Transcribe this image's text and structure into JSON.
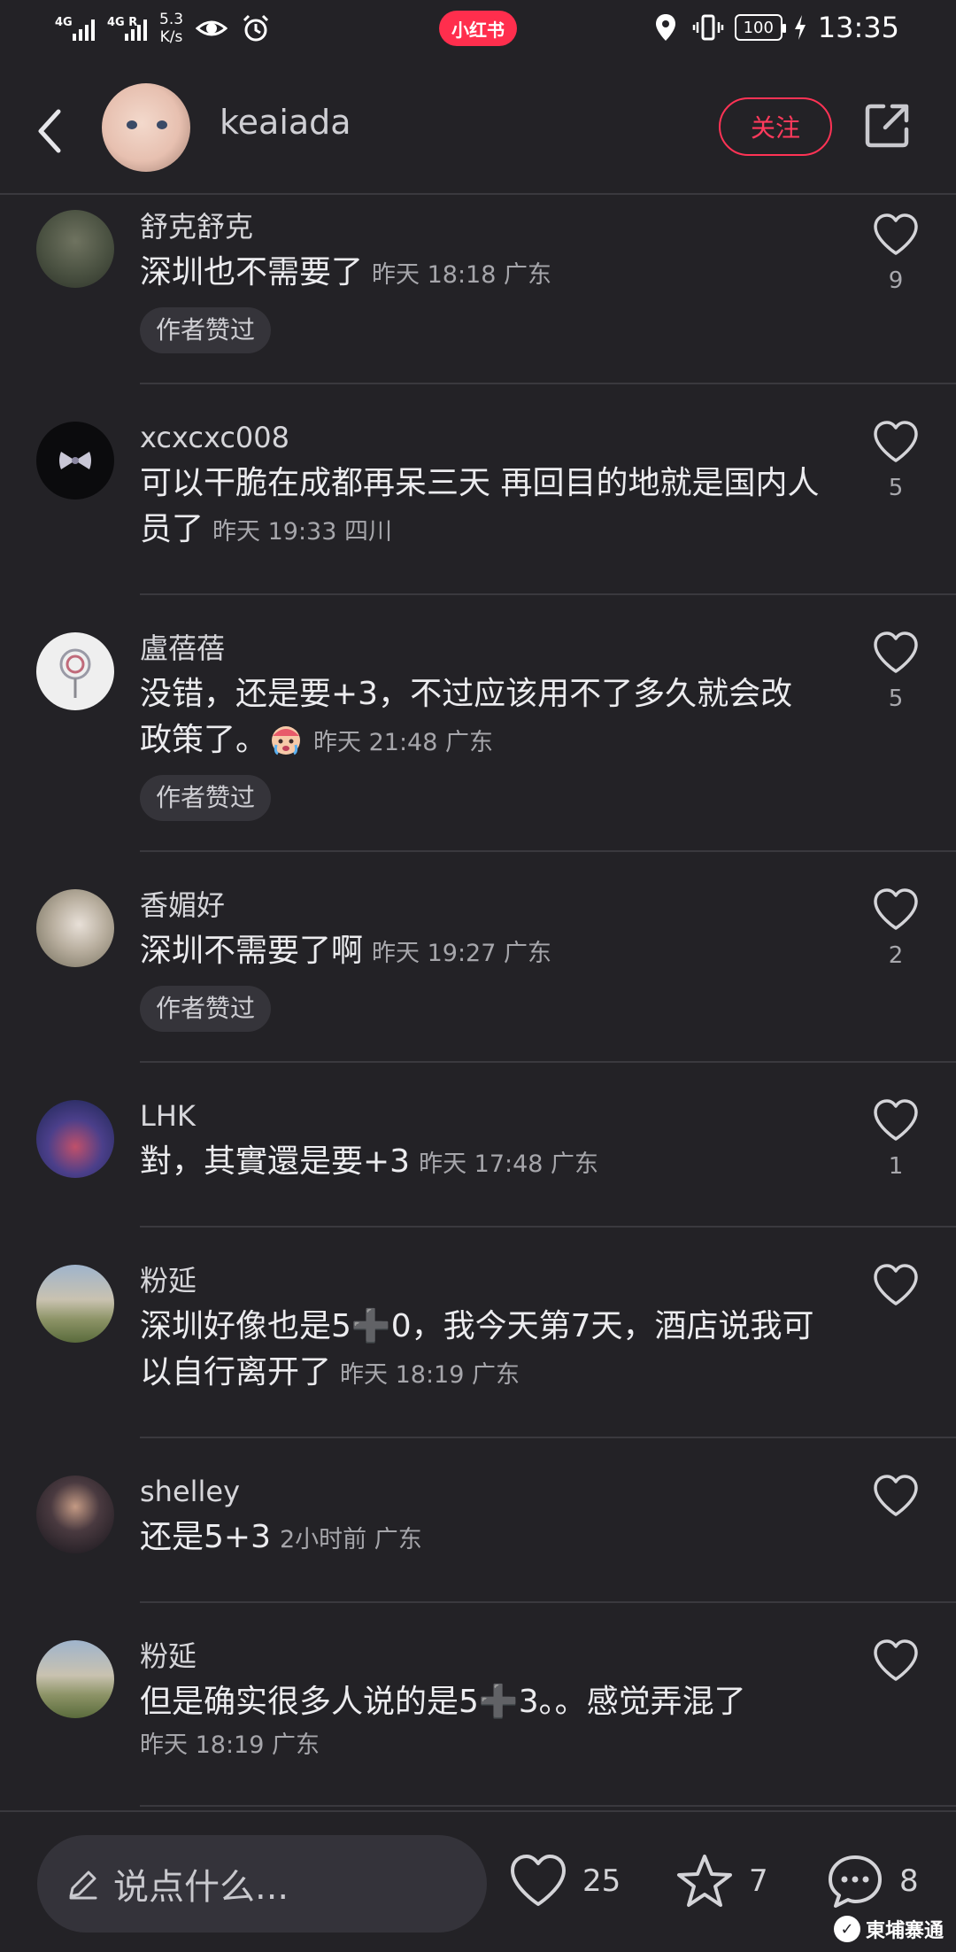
{
  "status_bar": {
    "signal1": "4G",
    "signal2": "4G R",
    "speed_top": "5.3",
    "speed_bottom": "K/s",
    "app_badge": "小红书",
    "battery": "100",
    "time": "13:35"
  },
  "header": {
    "username": "keaiada",
    "follow_label": "关注"
  },
  "comments": [
    {
      "name": "舒克舒克",
      "text": "深圳也不需要了",
      "meta": "昨天 18:18 广东",
      "tag": "作者赞过",
      "likes": "9"
    },
    {
      "name": "xcxcxc008",
      "text": "可以干脆在成都再呆三天 再回目的地就是国内人员了",
      "meta": "昨天 19:33 四川",
      "tag": "",
      "likes": "5"
    },
    {
      "name": "盧蓓蓓",
      "text": "没错，还是要+3，不过应该用不了多久就会改政策了。",
      "meta": "昨天 21:48 广东",
      "tag": "作者赞过",
      "likes": "5"
    },
    {
      "name": "香媚好",
      "text": "深圳不需要了啊",
      "meta": "昨天 19:27 广东",
      "tag": "作者赞过",
      "likes": "2"
    },
    {
      "name": "LHK",
      "text": "對，其實還是要+3",
      "meta": "昨天 17:48 广东",
      "tag": "",
      "likes": "1"
    },
    {
      "name": "粉延",
      "text": "深圳好像也是5➕0，我今天第7天，酒店说我可以自行离开了",
      "meta": "昨天 18:19 广东",
      "tag": "",
      "likes": ""
    },
    {
      "name": "shelley",
      "text": "还是5+3",
      "meta": "2小时前  广东",
      "tag": "",
      "likes": ""
    },
    {
      "name": "粉延",
      "text": "但是确实很多人说的是5➕3。。感觉弄混了",
      "meta": "昨天 18:19 广东",
      "tag": "",
      "likes": ""
    }
  ],
  "bottom_bar": {
    "input_placeholder": "说点什么...",
    "likes": "25",
    "favorites": "7",
    "comments": "8"
  },
  "watermark": "東埔寨通"
}
